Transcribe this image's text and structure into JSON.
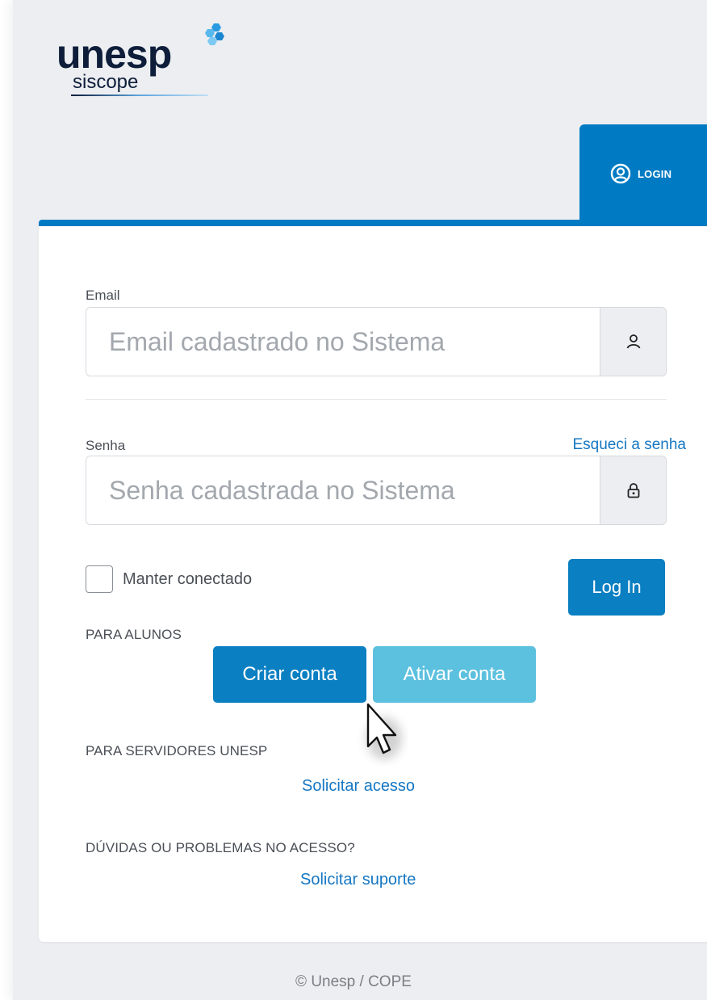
{
  "brand": {
    "name": "unesp",
    "product": "siscope"
  },
  "tabs": {
    "login_label": "LOGIN"
  },
  "form": {
    "email": {
      "label": "Email",
      "placeholder": "Email cadastrado no Sistema",
      "value": ""
    },
    "password": {
      "label": "Senha",
      "placeholder": "Senha cadastrada no Sistema",
      "value": "",
      "forgot_link": "Esqueci a senha"
    },
    "remember_label": "Manter conectado",
    "remember_checked": false,
    "submit_label": "Log In"
  },
  "students": {
    "heading": "PARA ALUNOS",
    "create_label": "Criar conta",
    "activate_label": "Ativar conta"
  },
  "staff": {
    "heading": "PARA SERVIDORES UNESP",
    "request_access": "Solicitar acesso"
  },
  "help": {
    "heading": "DÚVIDAS OU PROBLEMAS NO ACESSO?",
    "request_support": "Solicitar suporte"
  },
  "footer": {
    "copyright": "© Unesp / COPE"
  },
  "icons": {
    "user": "user-icon",
    "lock": "lock-icon",
    "login": "user-circle-icon",
    "cursor": "mouse-pointer-icon"
  },
  "colors": {
    "primary": "#007bc3",
    "secondary": "#5cc0df",
    "link": "#1577c3",
    "background": "#edeef1"
  }
}
